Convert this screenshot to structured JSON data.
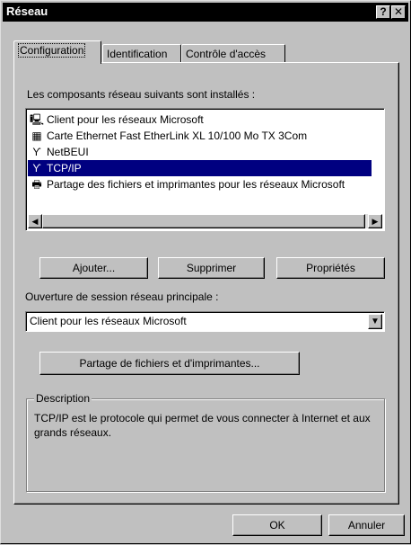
{
  "window": {
    "title": "Réseau",
    "help_button": "?",
    "close_button": "✕"
  },
  "tabs": [
    {
      "label": "Configuration"
    },
    {
      "label": "Identification"
    },
    {
      "label": "Contrôle d'accès"
    }
  ],
  "components": {
    "label": "Les composants réseau suivants sont installés :",
    "items": [
      {
        "icon": "client-icon",
        "glyph": "🖳",
        "label": "Client pour les réseaux Microsoft"
      },
      {
        "icon": "network-card-icon",
        "glyph": "▦",
        "label": "Carte Ethernet Fast EtherLink XL 10/100 Mo TX  3Com"
      },
      {
        "icon": "protocol-icon",
        "glyph": "ϒ",
        "label": "NetBEUI"
      },
      {
        "icon": "protocol-icon",
        "glyph": "ϒ",
        "label": "TCP/IP",
        "selected": true
      },
      {
        "icon": "service-icon",
        "glyph": "🖶",
        "label": "Partage des fichiers et imprimantes pour les réseaux Microsoft"
      }
    ]
  },
  "buttons": {
    "add": "Ajouter...",
    "remove": "Supprimer",
    "properties": "Propriétés"
  },
  "logon": {
    "label": "Ouverture de session réseau principale :",
    "value": "Client pour les réseaux Microsoft"
  },
  "sharing_button": "Partage de fichiers et d'imprimantes...",
  "description": {
    "label": "Description",
    "text": "TCP/IP est le protocole qui permet de vous connecter à Internet et aux grands réseaux."
  },
  "footer": {
    "ok": "OK",
    "cancel": "Annuler"
  },
  "colors": {
    "face": "#c0c0c0",
    "selection": "#000080",
    "titlebar": "#000000"
  }
}
